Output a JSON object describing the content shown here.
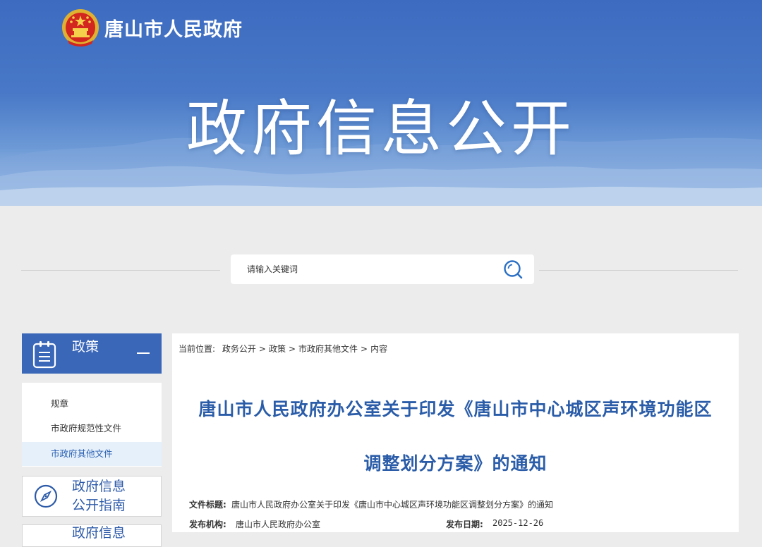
{
  "site": {
    "name": "唐山市人民政府"
  },
  "banner": {
    "title": "政府信息公开"
  },
  "search": {
    "placeholder": "请输入关键词"
  },
  "sidebar": {
    "section_title": "政策",
    "items": [
      {
        "label": "规章"
      },
      {
        "label": "市政府规范性文件"
      },
      {
        "label": "市政府其他文件"
      }
    ],
    "guide_box": {
      "line1": "政府信息",
      "line2": "公开指南"
    },
    "next_box": {
      "line1": "政府信息"
    }
  },
  "breadcrumb": {
    "prefix": "当前位置:",
    "items": [
      "政务公开",
      "政策",
      "市政府其他文件",
      "内容"
    ],
    "separator": ">"
  },
  "article": {
    "title_line1": "唐山市人民政府办公室关于印发《唐山市中心城区声环境功能区",
    "title_line2": "调整划分方案》的通知",
    "meta": {
      "doc_title_label": "文件标题:",
      "doc_title_value": "唐山市人民政府办公室关于印发《唐山市中心城区声环境功能区调整划分方案》的通知",
      "publisher_label": "发布机构:",
      "publisher_value": "唐山市人民政府办公室",
      "date_label": "发布日期:",
      "date_value": "2025-12-26"
    }
  },
  "colors": {
    "brand_blue": "#3a67b8",
    "title_blue": "#2a5ca8",
    "active_bg": "#e5f0fb"
  }
}
